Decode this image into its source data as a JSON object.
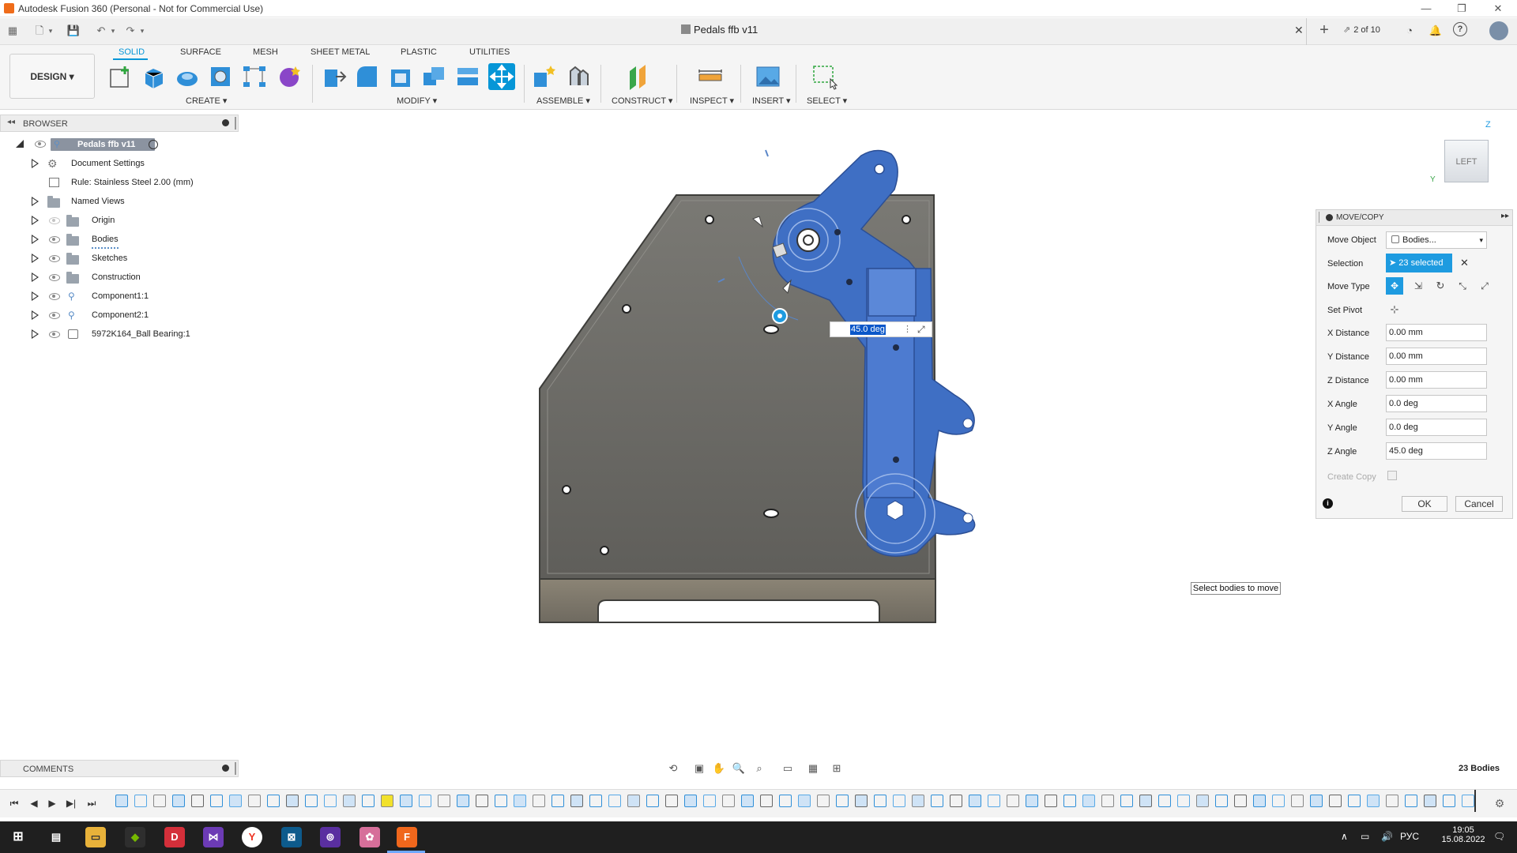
{
  "window": {
    "title": "Autodesk Fusion 360 (Personal - Not for Commercial Use)"
  },
  "document": {
    "tab_title": "Pedals ffb v11",
    "versions": "2 of 10"
  },
  "ribbon": {
    "tabs": [
      "SOLID",
      "SURFACE",
      "MESH",
      "SHEET METAL",
      "PLASTIC",
      "UTILITIES"
    ],
    "workspace": "DESIGN",
    "groups": {
      "create": "CREATE",
      "modify": "MODIFY",
      "assemble": "ASSEMBLE",
      "construct": "CONSTRUCT",
      "inspect": "INSPECT",
      "insert": "INSERT",
      "select": "SELECT"
    }
  },
  "browser": {
    "title": "BROWSER",
    "root": "Pedals ffb v11",
    "items": [
      {
        "label": "Document Settings"
      },
      {
        "label": "Rule: Stainless Steel 2.00 (mm)"
      },
      {
        "label": "Named Views"
      },
      {
        "label": "Origin"
      },
      {
        "label": "Bodies"
      },
      {
        "label": "Sketches"
      },
      {
        "label": "Construction"
      },
      {
        "label": "Component1:1"
      },
      {
        "label": "Component2:1"
      },
      {
        "label": "5972K164_Ball Bearing:1"
      }
    ]
  },
  "comments": {
    "label": "COMMENTS"
  },
  "viewcube": {
    "face": "LEFT",
    "axis_z": "Z",
    "axis_y": "Y"
  },
  "canvas": {
    "angle_input": "45.0 deg"
  },
  "move_copy": {
    "title": "MOVE/COPY",
    "move_object_label": "Move Object",
    "move_object_value": "Bodies...",
    "selection_label": "Selection",
    "selection_value": "23 selected",
    "move_type_label": "Move Type",
    "set_pivot_label": "Set Pivot",
    "x_distance_label": "X Distance",
    "x_distance": "0.00 mm",
    "y_distance_label": "Y Distance",
    "y_distance": "0.00 mm",
    "z_distance_label": "Z Distance",
    "z_distance": "0.00 mm",
    "x_angle_label": "X Angle",
    "x_angle": "0.0 deg",
    "y_angle_label": "Y Angle",
    "y_angle": "0.0 deg",
    "z_angle_label": "Z Angle",
    "z_angle": "45.0 deg",
    "create_copy_label": "Create Copy",
    "ok": "OK",
    "cancel": "Cancel"
  },
  "tooltip": "Select bodies to move",
  "status": {
    "bodies_count": "23 Bodies"
  },
  "taskbar": {
    "lang": "РУС",
    "time": "19:05",
    "date": "15.08.2022"
  },
  "colors": {
    "accent": "#0696d7",
    "selection_blue": "#3f6fc4",
    "plate": "#6b6a66"
  }
}
